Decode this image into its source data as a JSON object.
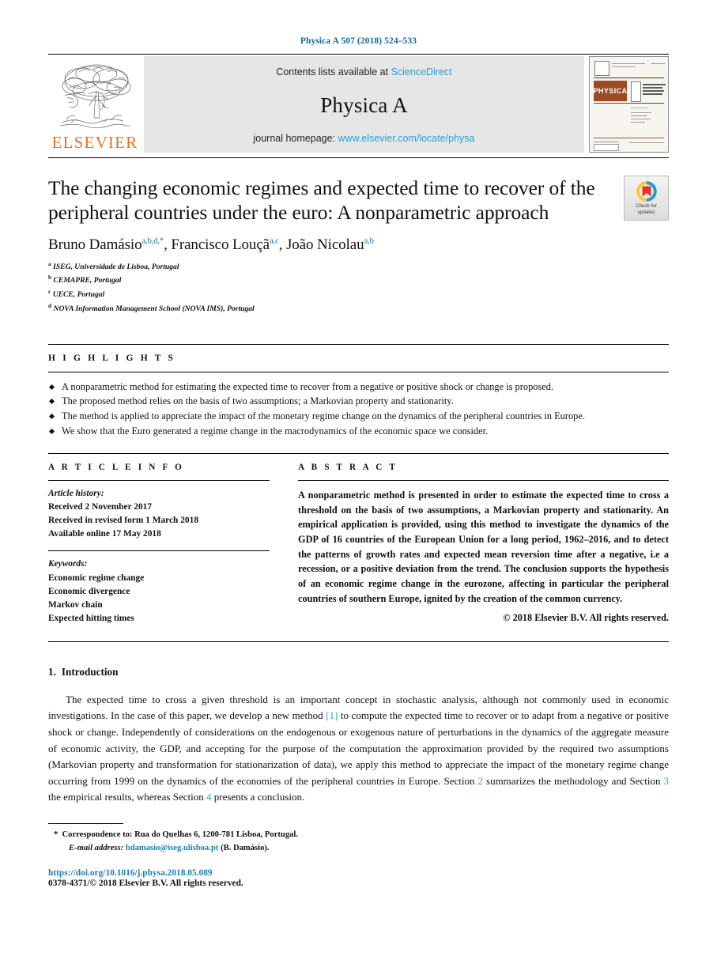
{
  "running_head": "Physica A 507 (2018) 524–533",
  "masthead": {
    "publisher_name": "ELSEVIER",
    "publisher_logo_icon": "elsevier-tree-logo",
    "contents_prefix": "Contents lists available at",
    "contents_link": "ScienceDirect",
    "journal_name": "Physica A",
    "homepage_prefix": "journal homepage:",
    "homepage_link": "www.elsevier.com/locate/physa",
    "cover_masthead": "PHYSICA",
    "cover_subtitle": "STATISTICAL MECHANICS AND ITS APPLICATIONS"
  },
  "colors": {
    "link_blue": "#2e9fd4",
    "head_blue": "#0d6ba5",
    "elsevier_orange": "#E9711C",
    "band_gray": "#e6e6e6"
  },
  "article": {
    "title": "The changing economic regimes and expected time to recover of the peripheral countries under the euro: A nonparametric approach",
    "crossmark_line1": "Check for",
    "crossmark_line2": "updates",
    "crossmark_icon": "crossmark-check-for-updates-icon",
    "authors": [
      {
        "name": "Bruno Damásio",
        "marks": "a,b,d,",
        "star": "*",
        "sep": ", "
      },
      {
        "name": "Francisco Louçã",
        "marks": "a,c",
        "star": "",
        "sep": ", "
      },
      {
        "name": "João Nicolau",
        "marks": "a,b",
        "star": "",
        "sep": ""
      }
    ],
    "affiliations": [
      {
        "mark": "a",
        "text": "ISEG, Universidade de Lisboa, Portugal"
      },
      {
        "mark": "b",
        "text": "CEMAPRE, Portugal"
      },
      {
        "mark": "c",
        "text": "UECE, Portugal"
      },
      {
        "mark": "d",
        "text": "NOVA Information Management School (NOVA IMS), Portugal"
      }
    ]
  },
  "highlights": {
    "heading": "H I G H L I G H T S",
    "items": [
      "A nonparametric method for estimating the expected time to recover from a negative or positive shock or change is proposed.",
      "The proposed method relies on the basis of two assumptions; a Markovian property and stationarity.",
      "The method is applied to appreciate the impact of the monetary regime change on the dynamics of the peripheral countries in Europe.",
      "We show that the Euro generated a regime change in the macrodynamics of the economic space we consider."
    ]
  },
  "article_info": {
    "heading": "A R T I C L E    I N F O",
    "history_label": "Article history:",
    "history": [
      "Received 2 November 2017",
      "Received in revised form 1 March 2018",
      "Available online 17 May 2018"
    ],
    "keywords_label": "Keywords:",
    "keywords": [
      "Economic regime change",
      "Economic divergence",
      "Markov chain",
      "Expected hitting times"
    ]
  },
  "abstract": {
    "heading": "A B S T R A C T",
    "text": "A nonparametric method is presented in order to estimate the expected time to cross a threshold on the basis of two assumptions, a Markovian property and stationarity. An empirical application is provided, using this method to investigate the dynamics of the GDP of 16 countries of the European Union for a long period, 1962–2016, and to detect the patterns of growth rates and expected mean reversion time after a negative, i.e a recession, or a positive deviation from the trend. The conclusion supports the hypothesis of an economic regime change in the eurozone, affecting in particular the peripheral countries of southern Europe, ignited by the creation of the common currency.",
    "copyright": "© 2018 Elsevier B.V. All rights reserved."
  },
  "introduction": {
    "number": "1.",
    "title": "Introduction",
    "paragraph_parts": [
      {
        "t": "The expected time to cross a given threshold is an important concept in stochastic analysis, although not commonly used in economic investigations. In the case of this paper, we develop a new method ",
        "link": false
      },
      {
        "t": "[1]",
        "link": true
      },
      {
        "t": " to compute the expected time to recover or to adapt from a negative or positive shock or change. Independently of considerations on the endogenous or exogenous nature of perturbations in the dynamics of the aggregate measure of economic activity, the GDP, and accepting for the purpose of the computation the approximation provided by the required two assumptions (Markovian property and transformation for stationarization of data), we apply this method to appreciate the impact of the monetary regime change occurring from 1999 on the dynamics of the economies of the peripheral countries in Europe. Section ",
        "link": false
      },
      {
        "t": "2",
        "link": true
      },
      {
        "t": " summarizes the methodology and Section ",
        "link": false
      },
      {
        "t": "3",
        "link": true
      },
      {
        "t": " the empirical results, whereas Section ",
        "link": false
      },
      {
        "t": "4",
        "link": true
      },
      {
        "t": " presents a conclusion.",
        "link": false
      }
    ]
  },
  "footnotes": {
    "star": "*",
    "correspondence": "Correspondence to: Rua do Quelhas 6, 1200-781 Lisboa, Portugal.",
    "email_label": "E-mail address:",
    "email": "bdamasio@iseg.ulisboa.pt",
    "email_suffix": "(B. Damásio).",
    "doi": "https://doi.org/10.1016/j.physa.2018.05.089",
    "issn": "0378-4371/© 2018 Elsevier B.V. All rights reserved."
  }
}
